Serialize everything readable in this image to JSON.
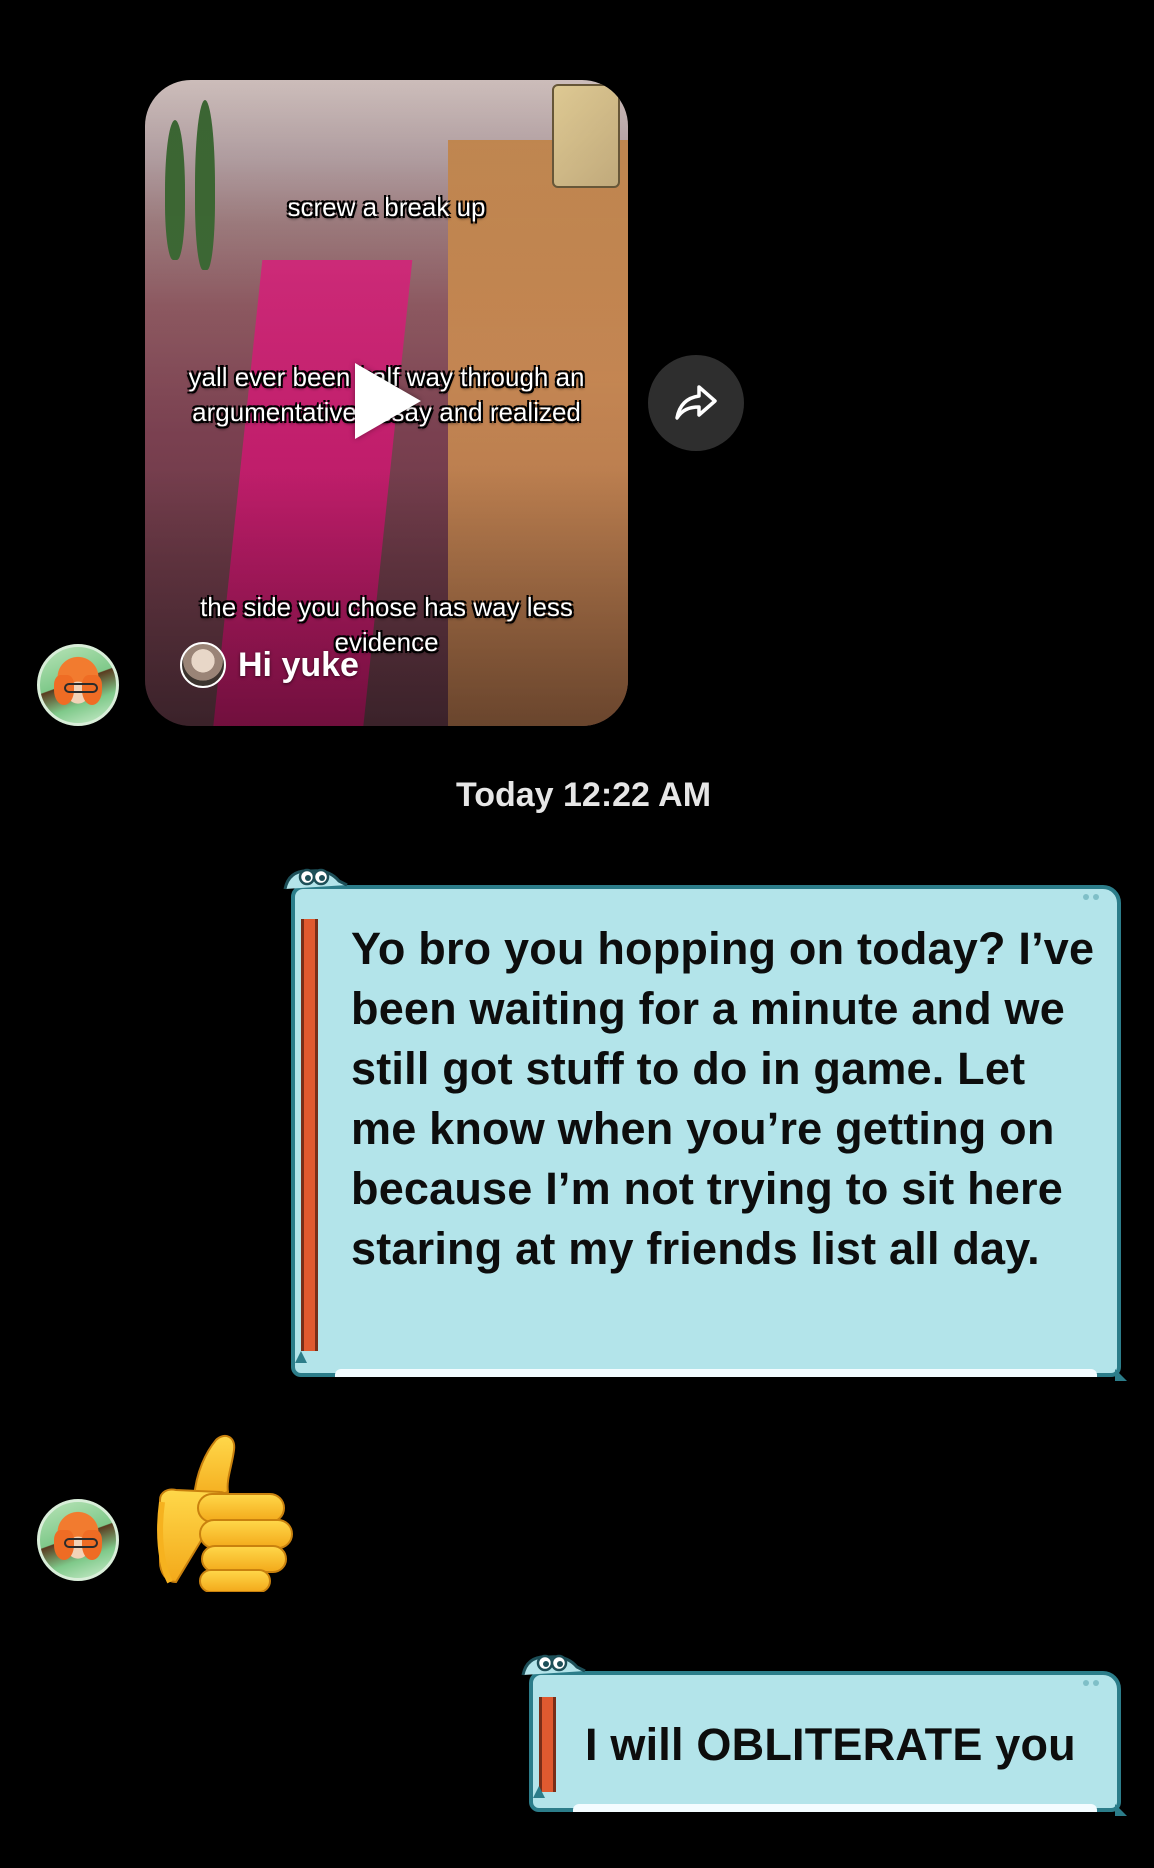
{
  "video_message": {
    "caption_top": "screw a break up",
    "caption_middle": "yall ever been half way through an argumentative essay and realized",
    "caption_bottom": "the side you chose has way less evidence",
    "creator_name": "Hi yuke",
    "play_icon": "play-icon",
    "share_icon": "share-arrow-icon"
  },
  "timestamp": "Today 12:22 AM",
  "messages": [
    {
      "sender": "self",
      "text": "Yo bro you hopping on today? I’ve been waiting for a minute and we still got stuff to do in game. Let me know when you’re getting on because I’m not trying to sit here staring at my friends list all day."
    },
    {
      "sender": "other",
      "emoji": "👍"
    },
    {
      "sender": "self",
      "text": "I will OBLITERATE you"
    }
  ],
  "colors": {
    "background": "#000000",
    "bubble_fill": "#b3e4ea",
    "bubble_border": "#2c7d8a",
    "bubble_stripe": "#e05a30",
    "timestamp_text": "#e6e6e6"
  }
}
